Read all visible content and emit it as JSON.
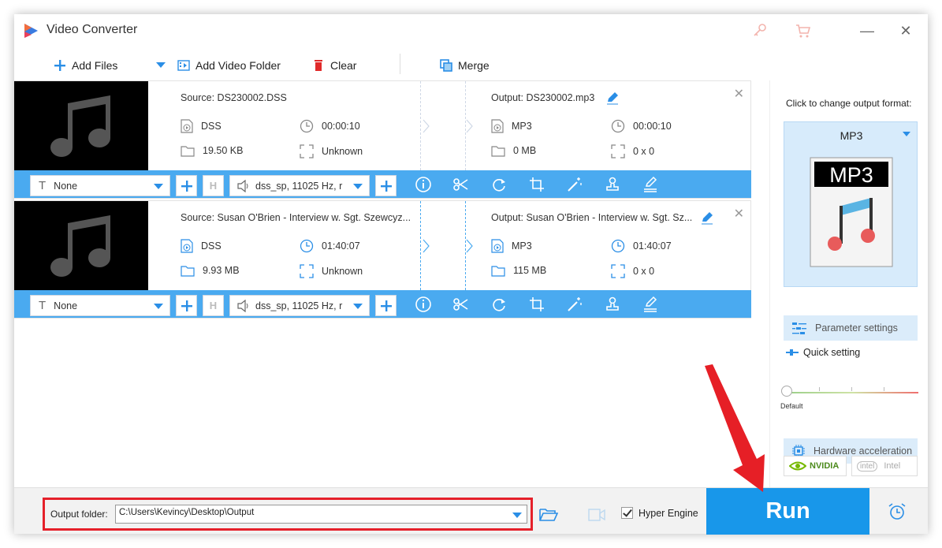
{
  "app": {
    "title": "Video Converter"
  },
  "toolbar": {
    "add_files": "Add Files",
    "add_video_folder": "Add Video Folder",
    "clear": "Clear",
    "merge": "Merge"
  },
  "files": [
    {
      "source_title": "Source: DS230002.DSS",
      "source_format": "DSS",
      "source_duration": "00:00:10",
      "source_size": "19.50 KB",
      "source_resolution": "Unknown",
      "output_title": "Output: DS230002.mp3",
      "output_format": "MP3",
      "output_duration": "00:00:10",
      "output_size": "0 MB",
      "output_resolution": "0 x 0",
      "subtitle": "None",
      "audio_track": "dss_sp, 11025 Hz, r"
    },
    {
      "source_title": "Source: Susan O'Brien - Interview w. Sgt. Szewcyz...",
      "source_format": "DSS",
      "source_duration": "01:40:07",
      "source_size": "9.93 MB",
      "source_resolution": "Unknown",
      "output_title": "Output: Susan O'Brien - Interview w. Sgt. Sz...",
      "output_format": "MP3",
      "output_duration": "01:40:07",
      "output_size": "115 MB",
      "output_resolution": "0 x 0",
      "subtitle": "None",
      "audio_track": "dss_sp, 11025 Hz, r"
    }
  ],
  "sidebar": {
    "caption": "Click to change output format:",
    "format_name": "MP3",
    "format_icon_text": "MP3",
    "parameter_settings": "Parameter settings",
    "quick_setting": "Quick setting",
    "slider_label": "Default",
    "hardware_acceleration": "Hardware acceleration",
    "nvidia": "NVIDIA",
    "intel": "Intel"
  },
  "bottom": {
    "output_folder_label": "Output folder:",
    "output_folder_value": "C:\\Users\\Kevincy\\Desktop\\Output",
    "hyper_engine": "Hyper Engine",
    "run": "Run"
  },
  "colors": {
    "accent": "#1897ea",
    "strip": "#4aaaf0",
    "highlight": "#e5202a"
  }
}
